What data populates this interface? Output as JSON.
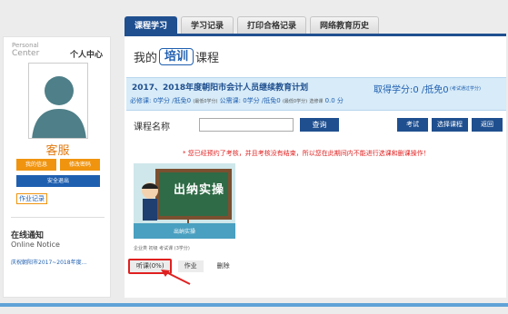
{
  "tabs": [
    {
      "label": "课程学习"
    },
    {
      "label": "学习记录"
    },
    {
      "label": "打印合格记录"
    },
    {
      "label": "网络教育历史"
    }
  ],
  "sidebar": {
    "pc_en_1": "Personal",
    "pc_en_2": "Center",
    "pc_cn": "个人中心",
    "name": "客服",
    "btn_info": "我的信息",
    "btn_password": "修改密码",
    "btn_logout": "安全退出",
    "btn_job": "作业记录",
    "notice_cn": "在线通知",
    "notice_en": "Online Notice",
    "notice_item": "庆祝朝阳市2017~2018年度..."
  },
  "main": {
    "title_pre": "我的",
    "title_hl": "培训",
    "title_post": "课程",
    "plan_title": "2017、2018年度朝阳市会计人员继续教育计划",
    "plan_credit": "取得学分:0 /抵免0",
    "plan_note": "(考试通过学分)",
    "line_a": "必修课:",
    "line_b": "0学分 /抵免0",
    "line_c": "(最低0学分)",
    "line_d": "公需课:",
    "line_e": "0学分 /抵免0",
    "line_f": "(最低0学分)",
    "line_g": "选修课",
    "line_h": "0.0 分",
    "search_label": "课程名称",
    "search_value": "",
    "btn_search": "查询",
    "btn_exam": "考试",
    "btn_choose": "选择课程",
    "btn_back": "返回",
    "warning": "* 您已经预约了考核，并且考核没有结束，所以您在此期间内不能进行选课和删课操作！",
    "course": {
      "board_text": "出纳实操",
      "caption": "出纳实操",
      "meta": "企业类  初级  考试课 (3学分)",
      "op_listen": "听课(0%)",
      "op_homework": "作业",
      "op_delete": "删除"
    }
  },
  "colors": {
    "accent": "#1f4f8f",
    "orange": "#f0940f",
    "warn": "#e02020",
    "plan_bg": "#d7ebf8"
  }
}
